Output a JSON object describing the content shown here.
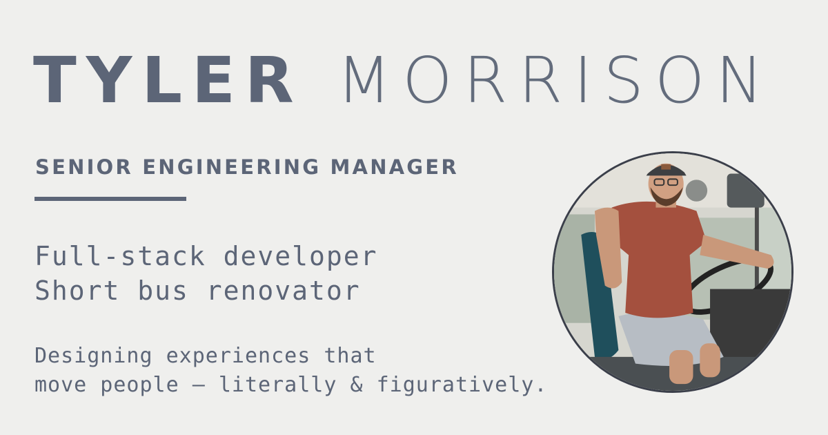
{
  "name": {
    "first": "TYLER",
    "last": "MORRISON"
  },
  "job_title": "SENIOR ENGINEERING MANAGER",
  "roles": [
    "Full-stack developer",
    "Short bus renovator"
  ],
  "tagline": [
    "Designing experiences that",
    "move people — literally & figuratively."
  ],
  "colors": {
    "background": "#efefed",
    "text": "#5c6577",
    "accent_rule": "#5c6577"
  }
}
